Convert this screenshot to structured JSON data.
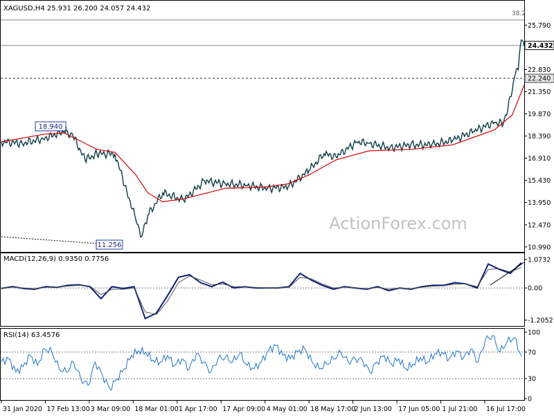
{
  "chart_data": {
    "type": "line",
    "title": "XAGUSD,H4  25.931 26.200 24.057 24.432",
    "symbol": "XAGUSD,H4",
    "ohlc": {
      "open": 25.931,
      "high": 26.2,
      "low": 24.057,
      "close": 24.432
    },
    "watermark": "ActionForex.com",
    "annotations": [
      {
        "label": "18.940",
        "value": 18.94,
        "kind": "swing-high"
      },
      {
        "label": "11.256",
        "value": 11.256,
        "kind": "swing-low"
      },
      {
        "label": "38.2",
        "kind": "fibonacci-level"
      }
    ],
    "levels": [
      {
        "label": "24.432",
        "value": 24.432,
        "kind": "current-price"
      },
      {
        "label": "22.240",
        "value": 22.24,
        "kind": "support",
        "style": "dashed"
      }
    ],
    "price_axis": {
      "ticks": [
        "25.790",
        "24.310",
        "22.830",
        "21.350",
        "19.870",
        "18.390",
        "16.910",
        "15.430",
        "13.950",
        "12.470",
        "10.990"
      ],
      "ylim": [
        10.75,
        26.45
      ]
    },
    "x_ticks": [
      "31 Jan 2020",
      "17 Feb 13:00",
      "3 Mar 09:00",
      "18 Mar 01:00",
      "1 Apr 17:00",
      "17 Apr 09:00",
      "4 May 01:00",
      "18 May 17:00",
      "2 Jun 13:00",
      "17 Jun 05:00",
      "1 Jul 21:00",
      "16 Jul 17:00"
    ],
    "x_range": [
      "2020-01-31",
      "2020-07-24"
    ],
    "series": [
      {
        "name": "XAGUSD,H4",
        "color": "#0c3a44",
        "x": [
          "2020-01-31",
          "2020-02-07",
          "2020-02-14",
          "2020-02-21",
          "2020-02-24",
          "2020-02-28",
          "2020-03-03",
          "2020-03-09",
          "2020-03-13",
          "2020-03-16",
          "2020-03-18",
          "2020-03-20",
          "2020-03-25",
          "2020-04-01",
          "2020-04-08",
          "2020-04-15",
          "2020-04-22",
          "2020-04-29",
          "2020-05-06",
          "2020-05-13",
          "2020-05-18",
          "2020-05-22",
          "2020-05-29",
          "2020-06-02",
          "2020-06-09",
          "2020-06-16",
          "2020-06-23",
          "2020-06-30",
          "2020-07-07",
          "2020-07-14",
          "2020-07-17",
          "2020-07-20",
          "2020-07-21",
          "2020-07-22",
          "2020-07-23",
          "2020-07-24"
        ],
        "y": [
          18.0,
          17.9,
          18.2,
          18.7,
          18.4,
          16.8,
          17.2,
          17.2,
          14.7,
          12.8,
          11.7,
          13.1,
          14.6,
          14.1,
          15.4,
          15.2,
          15.1,
          14.9,
          15.0,
          16.1,
          17.2,
          17.0,
          18.0,
          17.9,
          17.6,
          17.8,
          17.8,
          18.1,
          18.7,
          19.3,
          19.2,
          21.4,
          22.5,
          22.8,
          24.8,
          24.4
        ]
      },
      {
        "name": "Moving average",
        "color": "#d40000",
        "x": [
          "2020-01-31",
          "2020-02-14",
          "2020-02-21",
          "2020-03-03",
          "2020-03-09",
          "2020-03-16",
          "2020-03-20",
          "2020-03-25",
          "2020-04-01",
          "2020-04-15",
          "2020-04-29",
          "2020-05-06",
          "2020-05-13",
          "2020-05-22",
          "2020-06-02",
          "2020-06-16",
          "2020-06-30",
          "2020-07-07",
          "2020-07-14",
          "2020-07-20",
          "2020-07-24"
        ],
        "y": [
          18.0,
          18.5,
          18.6,
          17.5,
          17.3,
          15.8,
          14.6,
          14.0,
          14.2,
          14.9,
          15.0,
          15.2,
          15.8,
          16.8,
          17.4,
          17.5,
          17.8,
          18.3,
          18.8,
          19.8,
          21.8
        ]
      }
    ],
    "panels": [
      {
        "title": "MACD(12,26,9) 0.9350 0.7756",
        "ticks": [
          "1.0732",
          "0.00",
          "-1.2052"
        ],
        "ylim": [
          -1.35,
          1.2
        ],
        "series": [
          {
            "name": "MACD",
            "color": "#0a1d7a",
            "y": [
              -0.02,
              0.05,
              -0.02,
              -0.05,
              0.05,
              0.02,
              0.1,
              0.12,
              0.05,
              -0.4,
              0.05,
              -0.02,
              0.05,
              -1.15,
              -0.95,
              -0.3,
              0.4,
              0.5,
              0.2,
              0.05,
              0.22,
              0.0,
              0.05,
              0.0,
              0.0,
              0.0,
              0.05,
              0.55,
              0.3,
              0.1,
              -0.05,
              0.05,
              0.0,
              -0.05,
              0.05,
              -0.1,
              0.0,
              -0.05,
              0.05,
              0.1,
              0.1,
              0.2,
              0.15,
              0.0,
              0.9,
              0.7,
              0.55,
              0.95
            ]
          },
          {
            "name": "Signal",
            "color": "#555555",
            "y": [
              -0.02,
              0.03,
              0.0,
              -0.03,
              0.02,
              0.03,
              0.07,
              0.1,
              0.07,
              -0.25,
              -0.05,
              -0.05,
              0.0,
              -0.9,
              -1.0,
              -0.5,
              0.2,
              0.45,
              0.3,
              0.12,
              0.15,
              0.05,
              0.05,
              0.02,
              0.0,
              0.0,
              0.02,
              0.4,
              0.35,
              0.15,
              0.0,
              0.03,
              0.01,
              -0.03,
              0.02,
              -0.05,
              0.0,
              -0.03,
              0.03,
              0.07,
              0.08,
              0.15,
              0.15,
              0.05,
              0.7,
              0.72,
              0.6,
              0.78
            ]
          }
        ]
      },
      {
        "title": "RSI(14) 63.4576",
        "ticks": [
          "100",
          "70",
          "30",
          "0"
        ],
        "levels": [
          70,
          30
        ],
        "ylim": [
          0,
          100
        ],
        "series": [
          {
            "name": "RSI(14)",
            "color": "#1e74c9",
            "y": [
              55,
              60,
              40,
              48,
              65,
              50,
              75,
              70,
              45,
              40,
              55,
              30,
              20,
              55,
              35,
              15,
              30,
              45,
              65,
              72,
              70,
              58,
              55,
              65,
              50,
              60,
              45,
              68,
              55,
              40,
              60,
              62,
              55,
              68,
              50,
              45,
              55,
              72,
              80,
              65,
              60,
              70,
              75,
              55,
              45,
              52,
              60,
              70,
              55,
              60,
              58,
              40,
              55,
              65,
              52,
              60,
              45,
              52,
              62,
              55,
              68,
              70,
              60,
              72,
              62,
              75,
              55,
              88,
              95,
              70,
              85,
              92,
              63
            ]
          }
        ]
      }
    ],
    "grid": false,
    "legend": "none"
  }
}
